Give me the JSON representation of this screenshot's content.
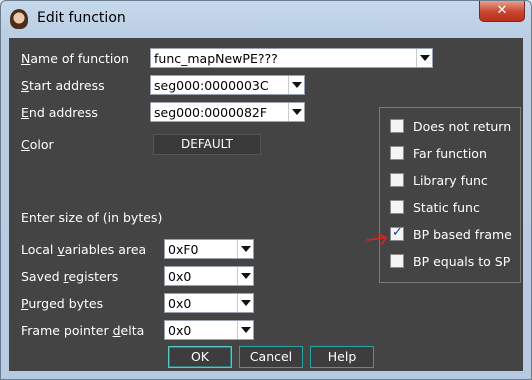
{
  "window": {
    "title": "Edit function",
    "close_label": "✕"
  },
  "fields": {
    "name": {
      "label_u": "N",
      "label_rest": "ame of function",
      "value": "func_mapNewPE???"
    },
    "start": {
      "label_u": "S",
      "label_rest": "tart address",
      "value": "seg000:0000003C"
    },
    "end": {
      "label_u": "E",
      "label_rest": "nd address",
      "value": "seg000:0000082F"
    },
    "color": {
      "label_u": "C",
      "label_rest": "olor",
      "value": "DEFAULT"
    }
  },
  "size_section": {
    "heading": "Enter size of (in bytes)"
  },
  "sizes": {
    "local_vars": {
      "label_pre": "Local ",
      "label_u": "v",
      "label_rest": "ariables area",
      "value": "0xF0"
    },
    "saved_regs": {
      "label_pre": "Saved ",
      "label_u": "r",
      "label_rest": "egisters",
      "value": "0x0"
    },
    "purged": {
      "label_pre": "",
      "label_u": "P",
      "label_rest": "urged bytes",
      "value": "0x0"
    },
    "frame_delta": {
      "label_pre": "Frame pointer ",
      "label_u": "d",
      "label_rest": "elta",
      "value": "0x0"
    }
  },
  "flags": [
    {
      "label": "Does not return",
      "checked": false
    },
    {
      "label": "Far function",
      "checked": false
    },
    {
      "label": "Library func",
      "checked": false
    },
    {
      "label": "Static func",
      "checked": false
    },
    {
      "label": "BP based frame",
      "checked": true
    },
    {
      "label": "BP equals to SP",
      "checked": false
    }
  ],
  "buttons": {
    "ok": "OK",
    "cancel": "Cancel",
    "help": "Help"
  },
  "colors": {
    "client_bg": "#444444",
    "annotation": "#e02020",
    "button_border": "#2aa3a3"
  }
}
